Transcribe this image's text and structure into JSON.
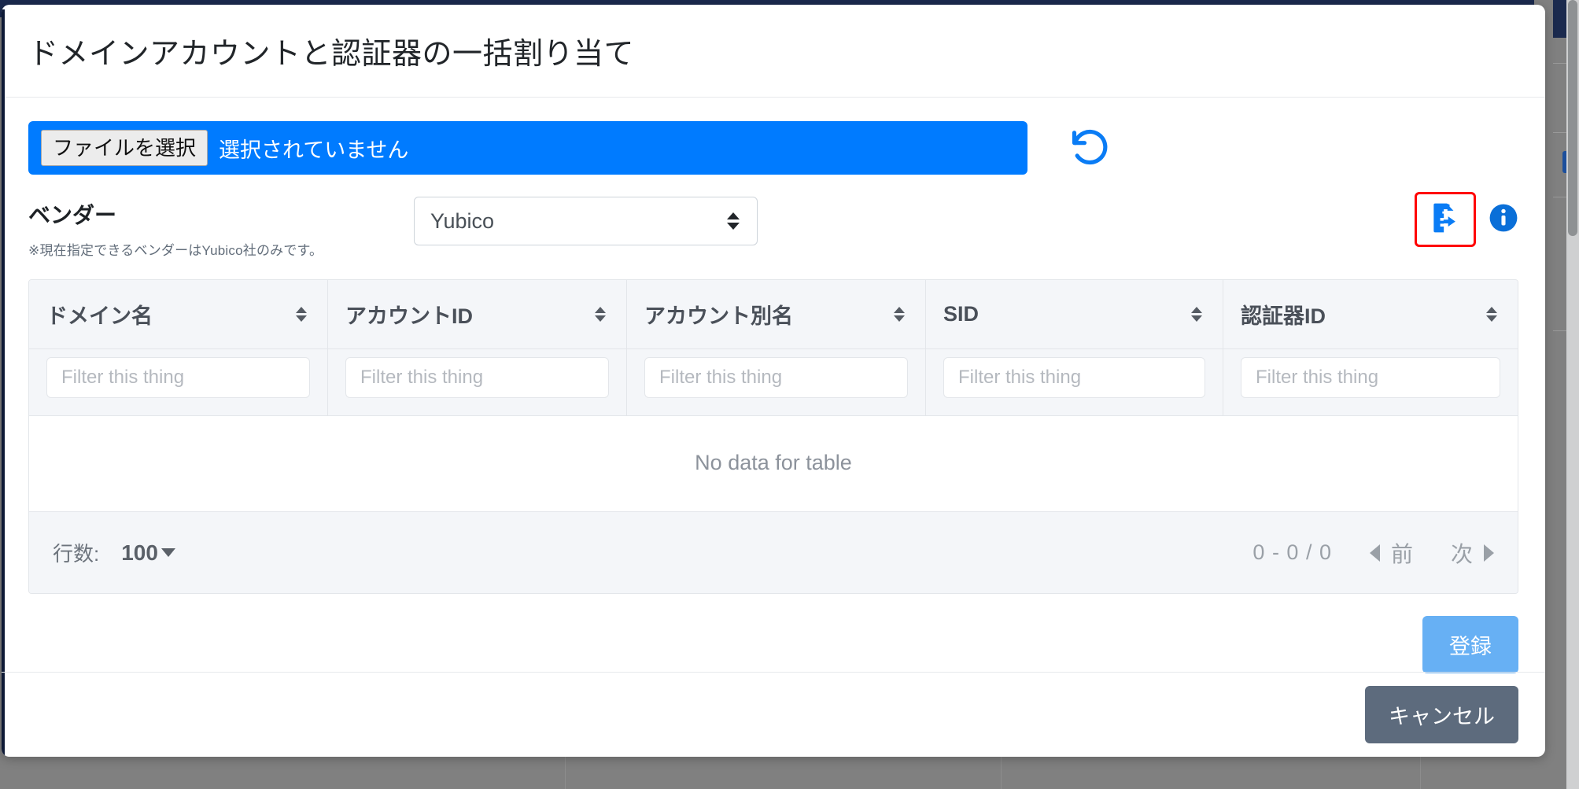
{
  "modal": {
    "title": "ドメインアカウントと認証器の一括割り当て",
    "file_picker": {
      "button_label": "ファイルを選択",
      "status_text": "選択されていません",
      "reset_icon": "undo-rotate-icon"
    },
    "vendor": {
      "label": "ベンダー",
      "note": "※現在指定できるベンダーはYubico社のみです。",
      "selected": "Yubico",
      "options": [
        "Yubico"
      ],
      "export_icon": "file-export-icon",
      "info_icon": "info-circle-icon"
    },
    "table": {
      "columns": [
        {
          "header": "ドメイン名",
          "filter_placeholder": "Filter this thing",
          "filter_value": ""
        },
        {
          "header": "アカウントID",
          "filter_placeholder": "Filter this thing",
          "filter_value": ""
        },
        {
          "header": "アカウント別名",
          "filter_placeholder": "Filter this thing",
          "filter_value": ""
        },
        {
          "header": "SID",
          "filter_placeholder": "Filter this thing",
          "filter_value": ""
        },
        {
          "header": "認証器ID",
          "filter_placeholder": "Filter this thing",
          "filter_value": ""
        }
      ],
      "rows": [],
      "empty_message": "No data for table",
      "footer": {
        "rows_per_page_label": "行数:",
        "rows_per_page_value": "100",
        "range_text": "0 - 0 / 0",
        "prev_label": "前",
        "next_label": "次"
      }
    },
    "submit_label": "登録",
    "cancel_label": "キャンセル"
  },
  "colors": {
    "accent_blue": "#007bff",
    "submit_blue": "#67b0f4",
    "cancel_slate": "#5d6b7d",
    "highlight_red": "#ff0000",
    "backdrop_navy": "#1b2a4e",
    "page_gray": "#808080"
  }
}
